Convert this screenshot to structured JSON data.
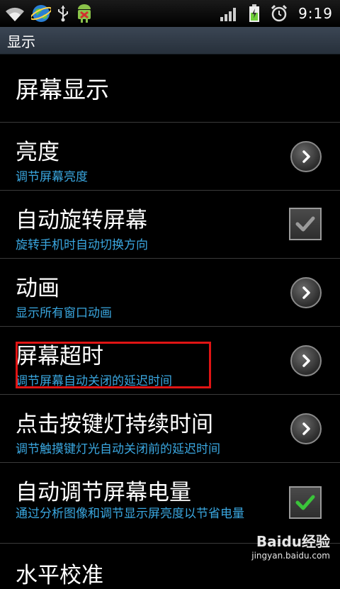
{
  "status_bar": {
    "time": "9:19",
    "icons": [
      "wifi-icon",
      "globe-icon",
      "usb-icon",
      "android-debug-icon",
      "signal-icon",
      "battery-charging-icon",
      "alarm-icon"
    ]
  },
  "title_bar": {
    "title": "显示"
  },
  "category": {
    "label": "屏幕显示"
  },
  "settings": [
    {
      "title": "亮度",
      "summary": "调节屏幕亮度",
      "control": "arrow"
    },
    {
      "title": "自动旋转屏幕",
      "summary": "旋转手机时自动切换方向",
      "control": "checkbox",
      "checked": true,
      "enabled": false
    },
    {
      "title": "动画",
      "summary": "显示所有窗口动画",
      "control": "arrow"
    },
    {
      "title": "屏幕超时",
      "summary": "调节屏幕自动关闭的延迟时间",
      "control": "arrow",
      "highlighted": true
    },
    {
      "title": "点击按键灯持续时间",
      "summary": "调节触摸键灯光自动关闭前的延迟时间",
      "control": "arrow"
    },
    {
      "title": "自动调节屏幕电量",
      "summary": "通过分析图像和调节显示屏亮度以节省电量",
      "control": "checkbox",
      "checked": true,
      "enabled": true
    }
  ],
  "partial_next": {
    "title": "水平校准"
  },
  "watermark": {
    "text": "Baidu经验",
    "sub": "jingyan.baidu.com"
  },
  "colors": {
    "summary": "#3aa7e0",
    "check_enabled": "#3ac43a",
    "check_disabled": "#9a9a9a",
    "highlight": "#e01414"
  }
}
